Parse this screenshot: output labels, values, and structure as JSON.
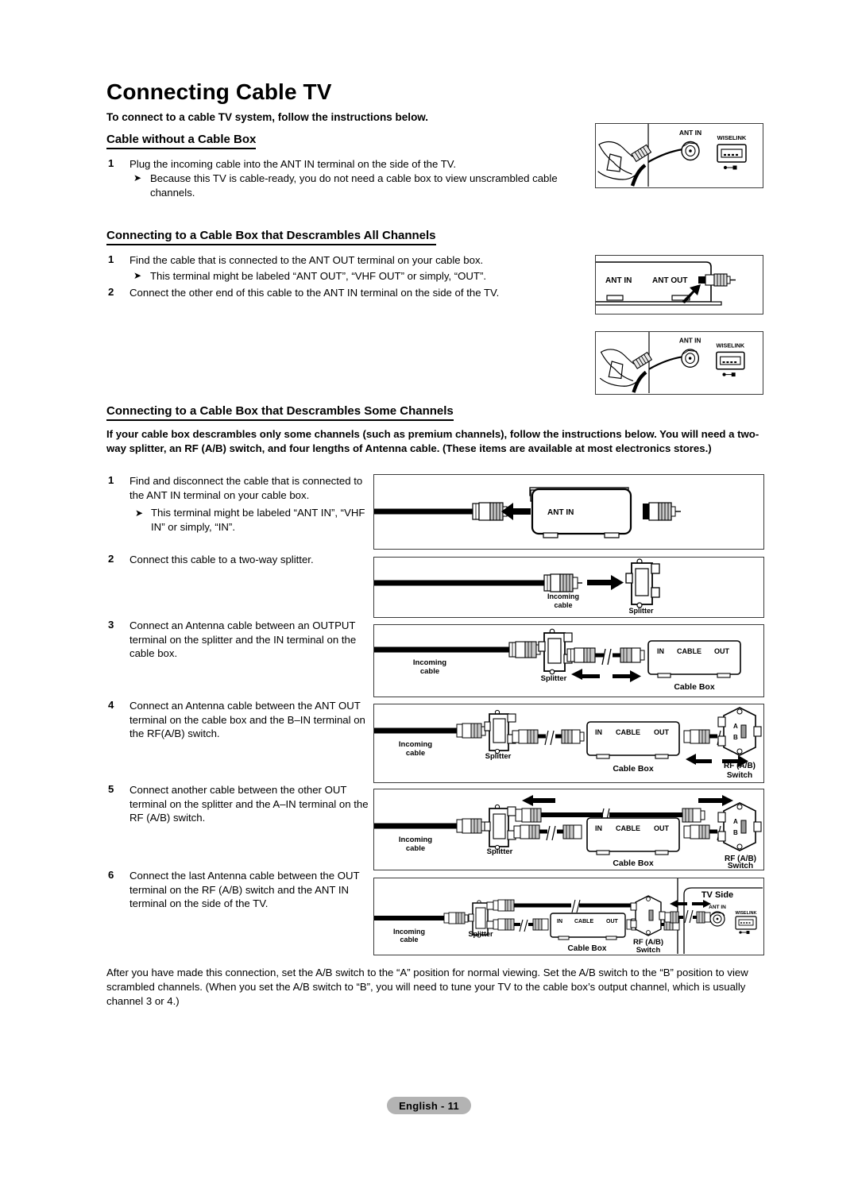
{
  "document": {
    "title": "Connecting Cable TV",
    "intro": "To connect to a cable TV system, follow the instructions below.",
    "footer_label": "English - 11"
  },
  "sections": [
    {
      "heading": "Cable without a Cable Box",
      "steps": [
        {
          "number": "1",
          "text": "Plug the incoming cable into the ANT IN terminal on the side of the TV."
        }
      ],
      "notes": [
        "Because this TV is cable-ready, you do not need a cable box to view unscrambled cable channels."
      ]
    },
    {
      "heading": "Connecting to a Cable Box that Descrambles All Channels",
      "steps": [
        {
          "number": "1",
          "text": "Find the cable that is connected to the ANT OUT terminal on your cable box."
        },
        {
          "number": "2",
          "text": "Connect the other end of this cable to the ANT IN terminal on the side of the TV."
        }
      ],
      "notes": [
        "This terminal might be labeled “ANT OUT”, “VHF OUT” or simply, “OUT”."
      ]
    },
    {
      "heading": "Connecting to a Cable Box that Descrambles Some Channels",
      "intro": " If your cable box descrambles only some channels (such as premium channels), follow the instructions below. You will need a two-way splitter, an RF (A/B) switch, and four lengths of Antenna cable. (These items are available at most electronics stores.)",
      "steps": [
        {
          "number": "1",
          "text": "Find and disconnect the cable that is connected to the ANT IN terminal on your cable box."
        },
        {
          "number": "2",
          "text": "Connect this cable to a two-way splitter."
        },
        {
          "number": "3",
          "text": "Connect an Antenna cable between an OUTPUT terminal on the splitter and the IN terminal on the cable box."
        },
        {
          "number": "4",
          "text": "Connect an Antenna cable between the ANT OUT terminal on the cable box and the B–IN terminal on the RF(A/B) switch."
        },
        {
          "number": "5",
          "text": "Connect another cable between the other OUT terminal on the splitter and the A–IN terminal on the RF (A/B) switch."
        },
        {
          "number": "6",
          "text": "Connect the last Antenna cable between the OUT terminal on the RF (A/B) switch and the ANT IN terminal on the side of the TV."
        }
      ],
      "notes": [
        "This terminal might be labeled “ANT IN”, “VHF IN” or simply, “IN”."
      ]
    }
  ],
  "closing_paragraph": "After you have made this connection, set the A/B switch to the “A” position for normal viewing. Set the A/B switch to the “B” position to view scrambled channels. (When you set the A/B switch to “B”, you will need to tune your TV to the cable box’s output channel, which is usually channel 3 or 4.)",
  "diagrams": {
    "tv_side_panel_1": {
      "name": "tv-side-panel-hand-plugging-cable",
      "labels": {
        "ant_in": "ANT IN",
        "wiselink": "WISELINK"
      }
    },
    "cable_box_rear": {
      "name": "cable-box-rear-ant-out",
      "labels": {
        "ant_in": "ANT IN",
        "ant_out": "ANT OUT"
      }
    },
    "tv_side_panel_2": {
      "name": "tv-side-panel-hand-plugging-cable",
      "labels": {
        "ant_in": "ANT IN",
        "wiselink": "WISELINK"
      }
    },
    "step1": {
      "name": "disconnect-cable-from-cable-box-ant-in",
      "labels": {
        "ant_in": "ANT IN"
      }
    },
    "step2": {
      "name": "connect-cable-to-splitter",
      "labels": {
        "incoming_cable_line1": "Incoming",
        "incoming_cable_line2": "cable",
        "splitter": "Splitter"
      }
    },
    "step3": {
      "name": "splitter-to-cable-box-in",
      "labels": {
        "incoming_cable_line1": "Incoming",
        "incoming_cable_line2": "cable",
        "splitter": "Splitter",
        "cable_box": "Cable Box",
        "box_in": "IN",
        "box_cable": "CABLE",
        "box_out": "OUT"
      }
    },
    "step4": {
      "name": "cable-box-out-to-rf-switch-b-in",
      "labels": {
        "incoming_cable_line1": "Incoming",
        "incoming_cable_line2": "cable",
        "splitter": "Splitter",
        "cable_box": "Cable Box",
        "box_in": "IN",
        "box_cable": "CABLE",
        "box_out": "OUT",
        "rf_switch_line1": "RF (A/B)",
        "rf_switch_line2": "Switch",
        "switch_a": "A",
        "switch_b": "B"
      }
    },
    "step5": {
      "name": "splitter-out-to-rf-switch-a-in",
      "labels": {
        "incoming_cable_line1": "Incoming",
        "incoming_cable_line2": "cable",
        "splitter": "Splitter",
        "cable_box": "Cable Box",
        "box_in": "IN",
        "box_cable": "CABLE",
        "box_out": "OUT",
        "rf_switch_line1": "RF (A/B)",
        "rf_switch_line2": "Switch",
        "switch_a": "A",
        "switch_b": "B"
      }
    },
    "step6": {
      "name": "rf-switch-out-to-tv-ant-in",
      "labels": {
        "incoming_cable_line1": "Incoming",
        "incoming_cable_line2": "cable",
        "splitter": "Splitter",
        "cable_box": "Cable Box",
        "box_in": "IN",
        "box_cable": "CABLE",
        "box_out": "OUT",
        "rf_switch_line1": "RF (A/B)",
        "rf_switch_line2": "Switch",
        "tv_side": "TV Side",
        "ant_in": "ANT IN",
        "wiselink": "WISELINK"
      }
    }
  }
}
